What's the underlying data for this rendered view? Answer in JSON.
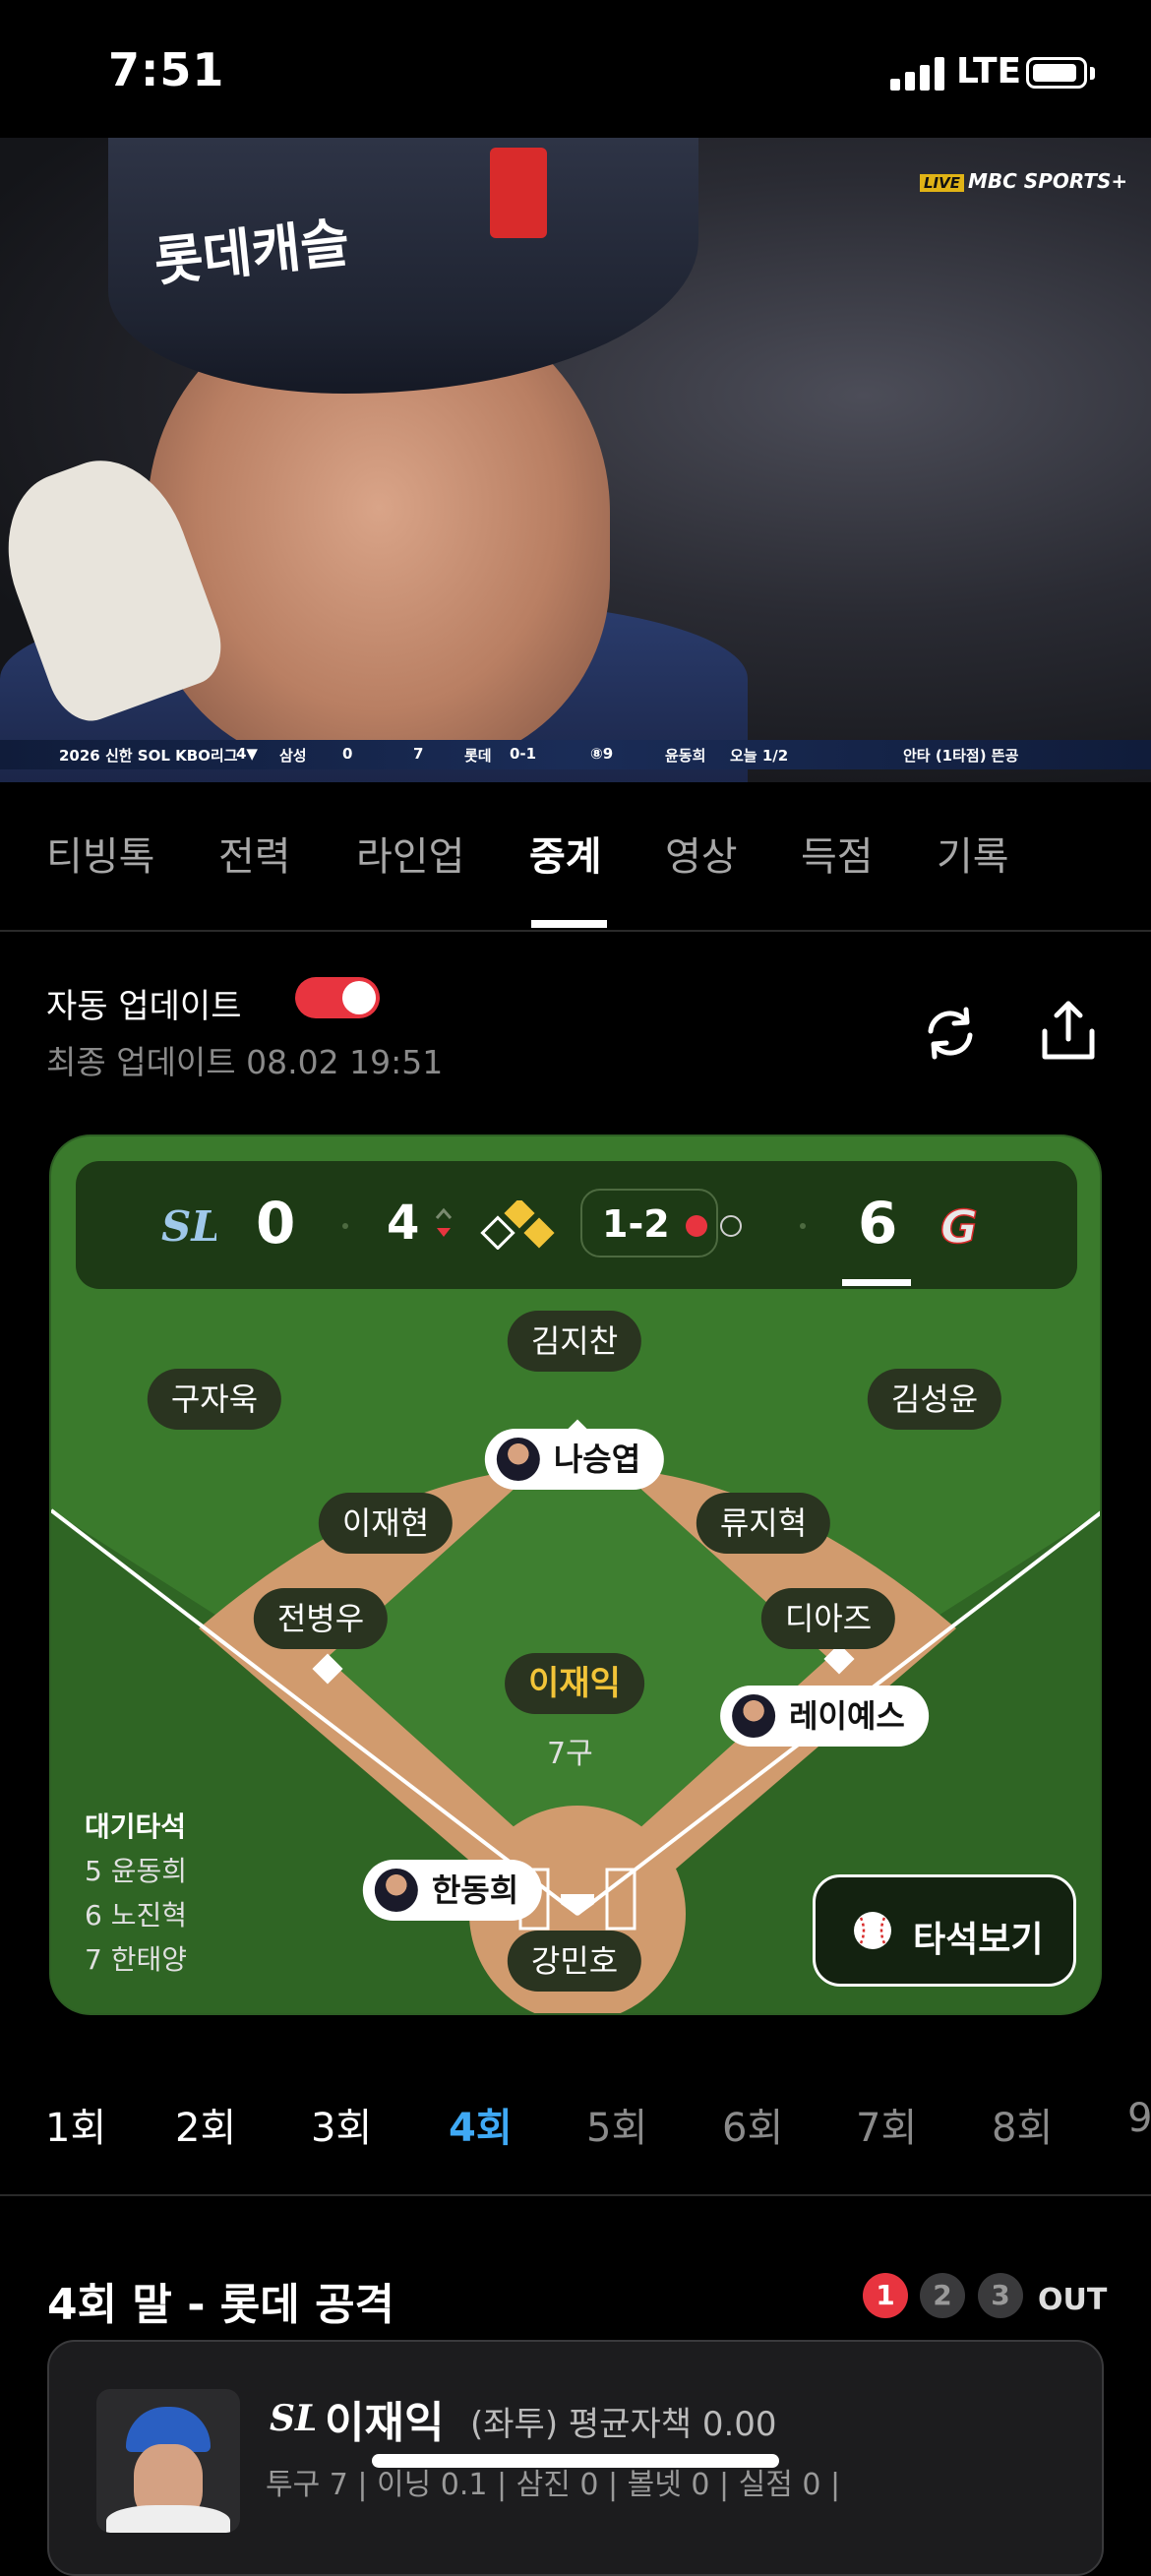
{
  "status": {
    "time": "7:51",
    "network": "LTE"
  },
  "video": {
    "watermark_live": "LIVE",
    "watermark": "MBC SPORTS+",
    "helmet_text": "롯데캐슬",
    "scorebug": {
      "league": "2026 신한 SOL KBO리그",
      "inning": "4▼",
      "team1": "삼성",
      "team1_score": "0",
      "team2_score": "7",
      "team2": "롯데",
      "count": "0-1",
      "pitch": "⑧9",
      "batter": "윤동희",
      "batter_today": "오늘 1/2",
      "last_result": "안타 (1타점) 뜬공"
    }
  },
  "tabs": [
    {
      "label": "티빙톡"
    },
    {
      "label": "전력"
    },
    {
      "label": "라인업"
    },
    {
      "label": "중계"
    },
    {
      "label": "영상"
    },
    {
      "label": "득점"
    },
    {
      "label": "기록"
    }
  ],
  "update": {
    "auto_label": "자동 업데이트",
    "auto_enabled": true,
    "last_update": "최종 업데이트 08.02 19:51"
  },
  "scoreboard": {
    "away_logo": "SL",
    "away_score": "0",
    "inning": "4",
    "count": "1-2",
    "home_score": "6",
    "home_logo": "G"
  },
  "field": {
    "cf": "김지찬",
    "lf": "구자욱",
    "rf": "김성윤",
    "ss_runner": "나승엽",
    "ss": "이재현",
    "second_base": "류지혁",
    "third_base": "전병우",
    "first_base": "디아즈",
    "pitcher": "이재익",
    "pitch_count": "7구",
    "runner_first": "레이예스",
    "batter": "한동희",
    "catcher": "강민호"
  },
  "on_deck": {
    "title": "대기타석",
    "items": [
      "5 윤동희",
      "6 노진혁",
      "7 한태양"
    ]
  },
  "atbat_button": "타석보기",
  "innings": [
    "1회",
    "2회",
    "3회",
    "4회",
    "5회",
    "6회",
    "7회",
    "8회",
    "9"
  ],
  "active_inning": "4회",
  "half_inning": {
    "title": "4회 말 - 롯데 공격",
    "outs": [
      "1",
      "2",
      "3"
    ],
    "out_label": "OUT"
  },
  "player_card": {
    "logo": "SL",
    "name": "이재익",
    "sub": "(좌투) 평균자책 0.00",
    "stats": "투구 7 | 이닝 0.1 | 삼진 0 | 볼넷 0 | 실점 0 |"
  },
  "colors": {
    "accent_red": "#e8343f",
    "field_green": "#3a7a2c",
    "infield": "#d19b6e",
    "active_inning": "#3fa9f5",
    "pitcher_name": "#f2c438"
  }
}
